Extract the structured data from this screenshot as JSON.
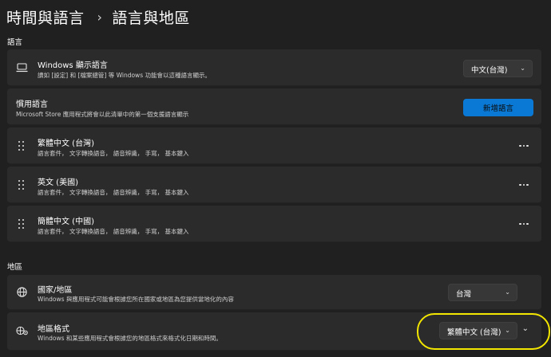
{
  "breadcrumb": {
    "parent": "時間與語言",
    "separator": "›",
    "current": "語言與地區"
  },
  "sections": {
    "language": "語言",
    "region": "地區"
  },
  "display_language": {
    "title": "Windows 顯示語言",
    "desc": "讀如 [設定] 和 [檔案總管] 等 Windows 功能會以這種語言顯示。",
    "value": "中文(台灣)",
    "chevron": "⌄"
  },
  "preferred": {
    "title": "慣用語言",
    "desc": "Microsoft Store 應用程式將會以此清單中的第一個支援語言顯示",
    "add_button": "新增語言"
  },
  "languages": [
    {
      "name": "繁體中文 (台灣)",
      "features": "語言套件， 文字轉換語音， 語音辨識， 手寫， 基本鍵入"
    },
    {
      "name": "英文 (美國)",
      "features": "語言套件， 文字轉換語音， 語音辨識， 手寫， 基本鍵入"
    },
    {
      "name": "簡體中文 (中國)",
      "features": "語言套件， 文字轉換語音， 語音辨識， 手寫， 基本鍵入"
    }
  ],
  "country": {
    "title": "國家/地區",
    "desc": "Windows 與應用程式可能會根據您所在國家或地區為您提供當地化的內容",
    "value": "台灣",
    "chevron": "⌄"
  },
  "regional_format": {
    "title": "地區格式",
    "desc": "Windows 和某些應用程式會根據您的地區格式來格式化日期和時間。",
    "value": "繁體中文 (台灣)",
    "chevron": "⌄",
    "expand": "⌄"
  },
  "icons": {
    "display": "laptop-icon",
    "grip": "drag-handle-icon",
    "more": "more-icon",
    "country": "globe-icon",
    "format": "regional-format-icon"
  },
  "colors": {
    "accent": "#0a79d5",
    "highlight": "#f3e600",
    "card": "#2b2b2b",
    "background": "#202020"
  }
}
